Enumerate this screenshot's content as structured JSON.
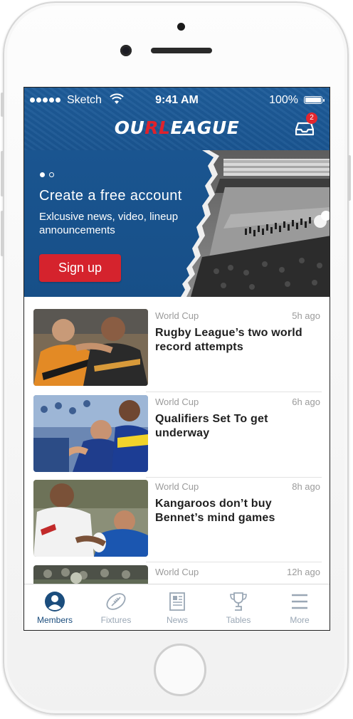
{
  "status_bar": {
    "carrier": "Sketch",
    "time": "9:41 AM",
    "battery": "100%"
  },
  "header": {
    "logo_prefix": "OU",
    "logo_accent": "RL",
    "logo_suffix": "EAGUE",
    "inbox_badge": "2",
    "accent_color": "#e0222c",
    "brand_color": "#1a5591"
  },
  "hero": {
    "slide_count": 2,
    "active_slide": 1,
    "title": "Create a free account",
    "subtitle": "Exlcusive news, video, lineup announcements",
    "cta_label": "Sign up"
  },
  "news": [
    {
      "category": "World Cup",
      "time": "5h ago",
      "headline": "Rugby League’s two world record attempts"
    },
    {
      "category": "World Cup",
      "time": "6h ago",
      "headline": "Qualifiers Set To get underway"
    },
    {
      "category": "World Cup",
      "time": "8h ago",
      "headline": "Kangaroos don’t buy Bennet’s mind games"
    },
    {
      "category": "World Cup",
      "time": "12h ago",
      "headline": ""
    }
  ],
  "tabs": [
    {
      "label": "Members",
      "icon": "user-icon",
      "active": true
    },
    {
      "label": "Fixtures",
      "icon": "football-icon",
      "active": false
    },
    {
      "label": "News",
      "icon": "newspaper-icon",
      "active": false
    },
    {
      "label": "Tables",
      "icon": "trophy-icon",
      "active": false
    },
    {
      "label": "More",
      "icon": "menu-icon",
      "active": false
    }
  ]
}
